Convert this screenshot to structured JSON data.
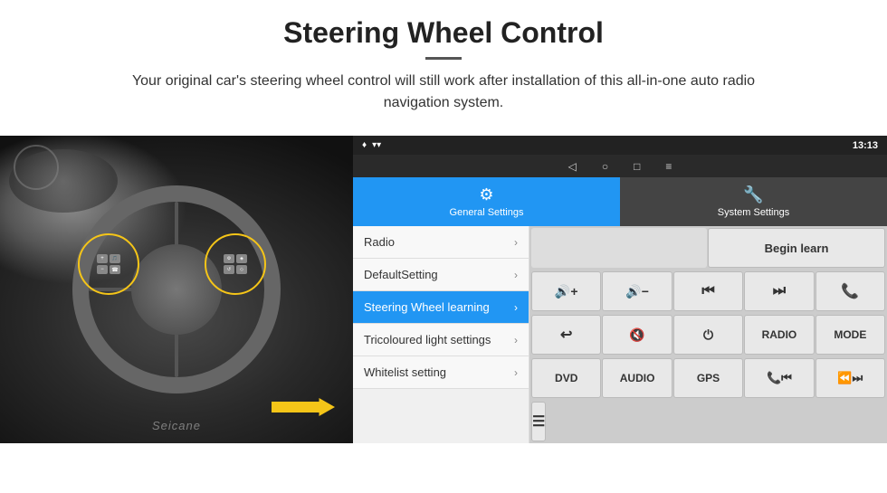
{
  "header": {
    "title": "Steering Wheel Control",
    "subtitle": "Your original car's steering wheel control will still work after installation of this all-in-one auto radio navigation system."
  },
  "android": {
    "status_bar": {
      "time": "13:13",
      "nav_back": "◁",
      "nav_home": "○",
      "nav_recents": "□",
      "nav_menu": "≡"
    },
    "tab_general_label": "General Settings",
    "tab_system_label": "System Settings",
    "menu_items": [
      {
        "label": "Radio",
        "active": false
      },
      {
        "label": "DefaultSetting",
        "active": false
      },
      {
        "label": "Steering Wheel learning",
        "active": true
      },
      {
        "label": "Tricoloured light settings",
        "active": false
      },
      {
        "label": "Whitelist setting",
        "active": false
      }
    ],
    "control_buttons": {
      "begin_learn": "Begin learn",
      "row1": [
        "🔊+",
        "🔊−",
        "⏮",
        "⏭",
        "📞"
      ],
      "row2": [
        "↩",
        "🔇",
        "⏻",
        "RADIO",
        "MODE"
      ],
      "row3": [
        "DVD",
        "AUDIO",
        "GPS",
        "📞⏮",
        "⏪⏭"
      ],
      "row4": [
        "☰"
      ]
    }
  },
  "watermark": "Seicane"
}
